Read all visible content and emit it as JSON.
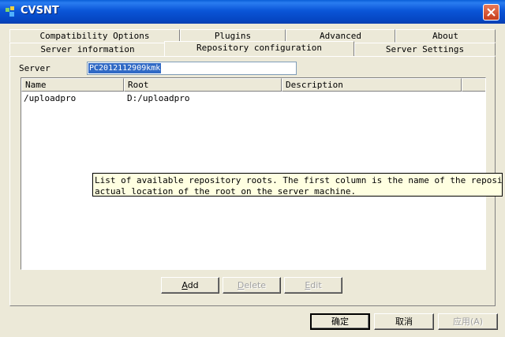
{
  "window": {
    "title": "CVSNT"
  },
  "tabs": {
    "row_back": [
      {
        "label": "Compatibility Options"
      },
      {
        "label": "Plugins"
      },
      {
        "label": "Advanced"
      },
      {
        "label": "About"
      }
    ],
    "row_front": [
      {
        "label": "Server information"
      },
      {
        "label": "Repository configuration",
        "active": true
      },
      {
        "label": "Server Settings"
      }
    ]
  },
  "server": {
    "label": "Server",
    "value": "PC2012112909kmk"
  },
  "list": {
    "columns": [
      "Name",
      "Root",
      "Description"
    ],
    "rows": [
      {
        "name": "/uploadpro",
        "root": "D:/uploadpro",
        "description": ""
      }
    ]
  },
  "tooltip": {
    "line1": "List of available repository roots.  The first column is the name of the repository s",
    "line2": "actual location of the root on the server machine."
  },
  "actions": {
    "add_first": "A",
    "add_rest": "dd",
    "delete_first": "D",
    "delete_rest": "elete",
    "edit_first": "E",
    "edit_rest": "dit"
  },
  "footer": {
    "ok": "确定",
    "cancel": "取消",
    "apply": "应用",
    "apply_key": "(A)"
  }
}
